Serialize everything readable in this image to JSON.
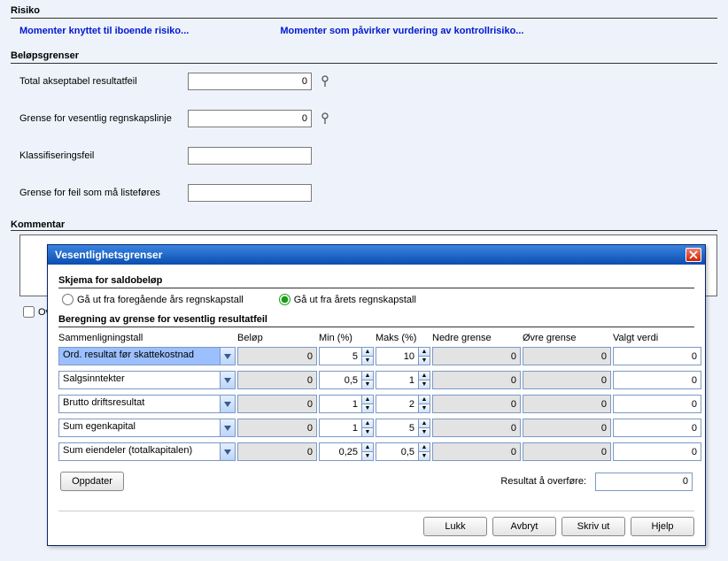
{
  "background": {
    "risiko_title": "Risiko",
    "link1": "Momenter knyttet til iboende risiko...",
    "link2": "Momenter som påvirker vurdering av kontrollrisiko...",
    "belop_title": "Beløpsgrenser",
    "rows": {
      "r1_label": "Total akseptabel resultatfeil",
      "r1_value": "0",
      "r2_label": "Grense for vesentlig regnskapslinje",
      "r2_value": "0",
      "r3_label": "Klassifiseringsfeil",
      "r3_value": "",
      "r4_label": "Grense for feil som må listeføres",
      "r4_value": ""
    },
    "kommentar_title": "Kommentar",
    "ove_label": "Ove"
  },
  "dialog": {
    "title": "Vesentlighetsgrenser",
    "section1": "Skjema for saldobeløp",
    "radio1": "Gå ut fra foregående års regnskapstall",
    "radio2": "Gå ut fra årets regnskapstall",
    "section2": "Beregning av grense for vesentlig resultatfeil",
    "head": {
      "c1": "Sammenligningstall",
      "c2": "Beløp",
      "c3": "Min (%)",
      "c4": "Maks (%)",
      "c5": "Nedre grense",
      "c6": "Øvre grense",
      "c7": "Valgt verdi"
    },
    "rows": [
      {
        "name": "Ord. resultat før skattekostnad",
        "sel": true,
        "belop": "0",
        "min": "5",
        "max": "10",
        "nedre": "0",
        "ovre": "0",
        "valgt": "0"
      },
      {
        "name": "Salgsinntekter",
        "sel": false,
        "belop": "0",
        "min": "0,5",
        "max": "1",
        "nedre": "0",
        "ovre": "0",
        "valgt": "0"
      },
      {
        "name": "Brutto driftsresultat",
        "sel": false,
        "belop": "0",
        "min": "1",
        "max": "2",
        "nedre": "0",
        "ovre": "0",
        "valgt": "0"
      },
      {
        "name": "Sum egenkapital",
        "sel": false,
        "belop": "0",
        "min": "1",
        "max": "5",
        "nedre": "0",
        "ovre": "0",
        "valgt": "0"
      },
      {
        "name": "Sum eiendeler (totalkapitalen)",
        "sel": false,
        "belop": "0",
        "min": "0,25",
        "max": "0,5",
        "nedre": "0",
        "ovre": "0",
        "valgt": "0"
      }
    ],
    "update_btn": "Oppdater",
    "result_label": "Resultat å overføre:",
    "result_value": "0",
    "buttons": {
      "lukk": "Lukk",
      "avbryt": "Avbryt",
      "skrivut": "Skriv ut",
      "hjelp": "Hjelp"
    }
  }
}
